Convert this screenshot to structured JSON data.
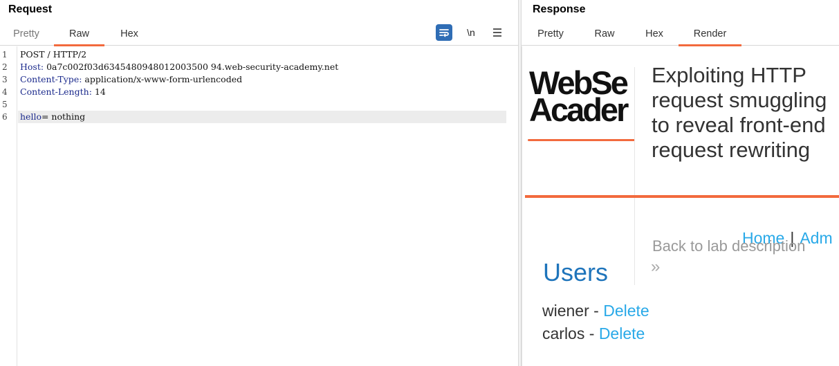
{
  "request": {
    "title": "Request",
    "tabs": [
      "Pretty",
      "Raw",
      "Hex"
    ],
    "active_tab": "Raw",
    "tools": {
      "wrap_icon": "word-wrap-icon",
      "newline_label": "\\n",
      "menu_icon": "hamburger-menu-icon"
    },
    "lines": [
      {
        "num": "1",
        "key": "",
        "value": "POST / HTTP/2"
      },
      {
        "num": "2",
        "key": "Host",
        "value": " 0a7c002f03d6345480948012003500 94.web-security-academy.net"
      },
      {
        "num": "3",
        "key": "Content-Type",
        "value": " application/x-www-form-urlencoded"
      },
      {
        "num": "4",
        "key": "Content-Length",
        "value": " 14"
      },
      {
        "num": "5",
        "key": "",
        "value": ""
      },
      {
        "num": "6",
        "key": "hello",
        "value": "= nothing"
      }
    ]
  },
  "response": {
    "title": "Response",
    "tabs": [
      "Pretty",
      "Raw",
      "Hex",
      "Render"
    ],
    "active_tab": "Render",
    "render": {
      "logo_line1": "WebSe",
      "logo_line2": "Acader",
      "lab_title": "Exploiting HTTP request smuggling to reveal front-end request rewriting",
      "back_link": "Back to lab description",
      "chevron": "»",
      "nav_home": "Home",
      "nav_sep": "|",
      "nav_admin": "Adm",
      "users_heading": "Users",
      "users": [
        {
          "name": "wiener",
          "sep": " - ",
          "action": "Delete"
        },
        {
          "name": "carlos",
          "sep": " - ",
          "action": "Delete"
        }
      ]
    }
  },
  "colors": {
    "accent": "#f26a3d",
    "link": "#29a9e8",
    "heading_blue": "#1e74bb",
    "wrap_button": "#2f6db5"
  }
}
